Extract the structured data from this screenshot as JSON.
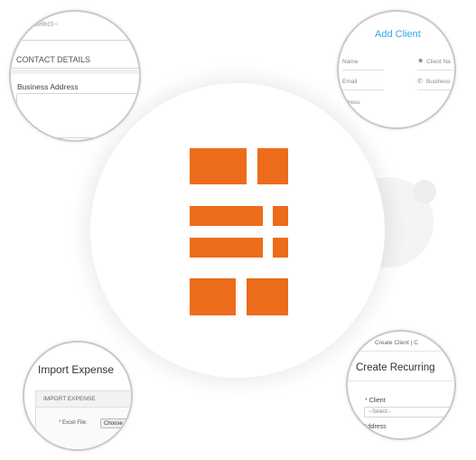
{
  "colors": {
    "brand_orange": "#ec6c1c",
    "link_blue": "#2fa9e6"
  },
  "top_left": {
    "select_placeholder": "--Select--",
    "section_title": "CONTACT DETAILS",
    "business_address_label": "Business Address"
  },
  "top_right": {
    "title": "Add Client",
    "fields": {
      "name": "Name",
      "client_name": "Client Na",
      "email": "Email",
      "business": "Business",
      "address": "ddress"
    },
    "icons": {
      "user": "user-icon",
      "phone": "phone-icon"
    }
  },
  "bottom_left": {
    "title": "Import Expense",
    "panel_header": "IMPORT EXPENSE",
    "file_label": "* Excel File:",
    "choose_button": "Choose"
  },
  "bottom_right": {
    "breadcrumb": "Create Client  |  C",
    "title": "Create Recurring",
    "client_label": "Client",
    "required_mark": "*",
    "select_placeholder": "--Select--",
    "address_label": "Address"
  }
}
